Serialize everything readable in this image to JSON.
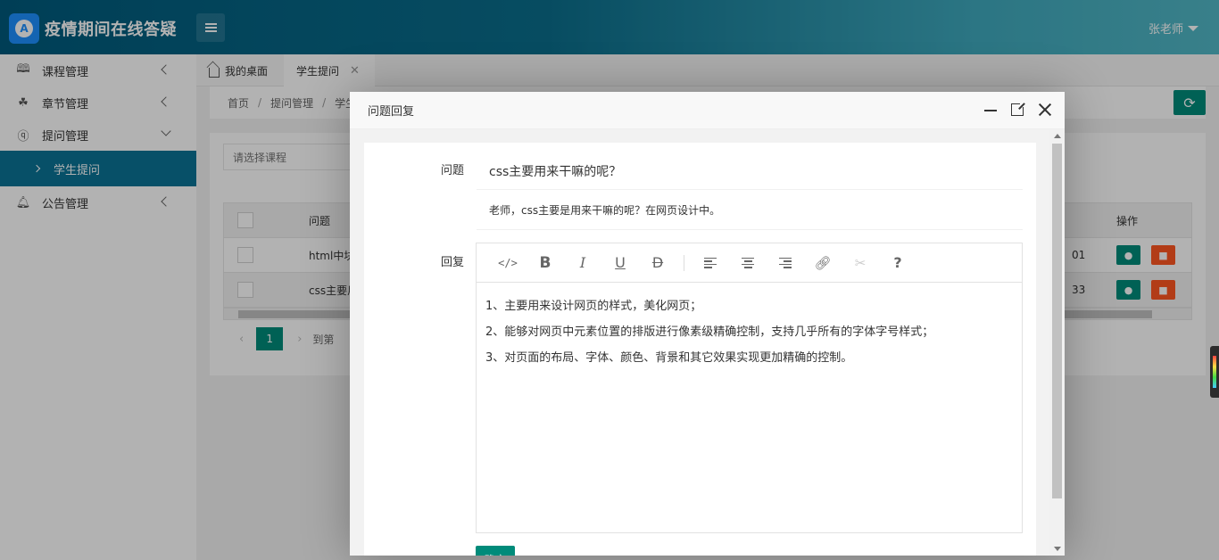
{
  "app": {
    "title": "疫情期间在线答疑",
    "logo_letter": "A"
  },
  "header": {
    "user_name": "张老师"
  },
  "sidebar": {
    "items": [
      {
        "label": "课程管理",
        "icon": "book-icon"
      },
      {
        "label": "章节管理",
        "icon": "clover-icon"
      },
      {
        "label": "提问管理",
        "icon": "question-circle-icon"
      },
      {
        "label": "学生提问",
        "icon": "chevron-right-icon",
        "active": true
      },
      {
        "label": "公告管理",
        "icon": "bell-icon"
      }
    ]
  },
  "tabs": [
    {
      "label": "我的桌面",
      "icon": "home-icon"
    },
    {
      "label": "学生提问",
      "close": "✕"
    }
  ],
  "breadcrumb": [
    "首页",
    "提问管理",
    "学生"
  ],
  "filter": {
    "course_placeholder": "请选择课程"
  },
  "table": {
    "headers": {
      "question": "问题",
      "actions": "操作"
    },
    "rows": [
      {
        "question": "html中块",
        "trail": "01"
      },
      {
        "question": "css主要用",
        "trail": "33"
      }
    ]
  },
  "pager": {
    "current": "1",
    "goto_label": "到第"
  },
  "modal": {
    "title": "问题回复",
    "question_label": "问题",
    "question_title": "css主要用来干嘛的呢？",
    "question_detail": "老师，css主要是用来干嘛的呢？在网页设计中。",
    "reply_label": "回复",
    "reply_lines": [
      "1、主要用来设计网页的样式，美化网页；",
      "2、能够对网页中元素位置的排版进行像素级精确控制，支持几乎所有的字体字号样式；",
      "3、对页面的布局、字体、颜色、背景和其它效果实现更加精确的控制。"
    ],
    "submit_label": "确定",
    "toolbar": {
      "code": "</>",
      "bold": "B",
      "italic": "I",
      "underline": "U",
      "strike": "D",
      "help": "?"
    }
  },
  "colors": {
    "accent": "#008b7a",
    "danger": "#ff5722",
    "sidebar_active": "#0b7396"
  }
}
